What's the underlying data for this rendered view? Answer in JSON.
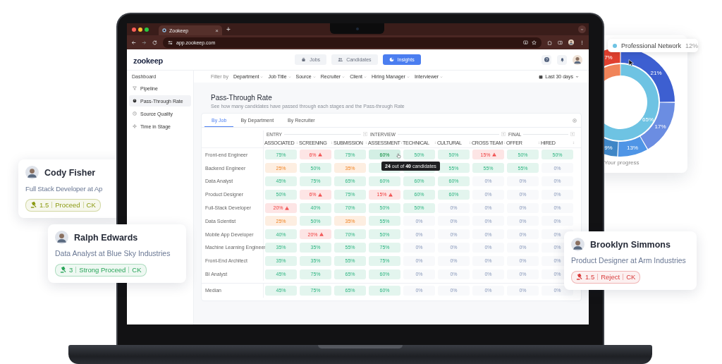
{
  "browser": {
    "tab_title": "Zookeep",
    "tab_close": "×",
    "new_tab": "+",
    "url": "app.zookeep.com"
  },
  "app": {
    "logo": "zookeep",
    "nav": [
      {
        "label": "Jobs",
        "selected": false
      },
      {
        "label": "Candidates",
        "selected": false
      },
      {
        "label": "Insights",
        "selected": true
      }
    ]
  },
  "sidebar": {
    "heading": "Dashboard",
    "items": [
      {
        "label": "Pipeline",
        "selected": false
      },
      {
        "label": "Pass-Through Rate",
        "selected": true
      },
      {
        "label": "Source Quality",
        "selected": false
      },
      {
        "label": "Time in Stage",
        "selected": false
      }
    ]
  },
  "filters": {
    "label": "Filter by",
    "items": [
      "Department",
      "Job Title",
      "Source",
      "Recruiter",
      "Client",
      "Hiring Manager",
      "Interviewer"
    ],
    "date_range": "Last 30 days"
  },
  "report": {
    "title": "Pass-Through Rate",
    "subtitle": "See how many candidates have passed through each stages and the Pass-through Rate",
    "tabs": [
      {
        "label": "By Job",
        "selected": true
      },
      {
        "label": "By Department",
        "selected": false
      },
      {
        "label": "By Recruiter",
        "selected": false
      }
    ],
    "stage_groups": [
      {
        "label": "ENTRY",
        "columns": [
          "ASSOCIATED",
          "SCREENING",
          "SUBMISSION"
        ]
      },
      {
        "label": "INTERVIEW",
        "columns": [
          "ASSESSMENT",
          "TECHNICAL",
          "CULTURAL",
          "CROSS TEAM"
        ]
      },
      {
        "label": "FINAL",
        "columns": [
          "OFFER",
          "HIRED"
        ]
      }
    ],
    "rows": [
      {
        "job": "Front-end Engineer",
        "cells": [
          {
            "value": "75%",
            "color": "#e3f5ee",
            "alert": false
          },
          {
            "value": "6%",
            "color": "#fde5e5",
            "alert": true
          },
          {
            "value": "75%",
            "color": "#e3f5ee",
            "alert": false
          },
          {
            "value": "60%",
            "color": "#d3efe4",
            "alert": false
          },
          {
            "value": "50%",
            "color": "#e3f5ee",
            "alert": false
          },
          {
            "value": "50%",
            "color": "#e3f5ee",
            "alert": false
          },
          {
            "value": "15%",
            "color": "#fde5e5",
            "alert": true
          },
          {
            "value": "50%",
            "color": "#e3f5ee",
            "alert": false
          },
          {
            "value": "50%",
            "color": "#e3f5ee",
            "alert": false
          }
        ]
      },
      {
        "job": "Backend Engineer",
        "cells": [
          {
            "value": "25%",
            "color": "#fdeee1",
            "alert": false
          },
          {
            "value": "50%",
            "color": "#e3f5ee",
            "alert": false
          },
          {
            "value": "35%",
            "color": "#fdeee1",
            "alert": false
          },
          {
            "color": "#e3f5ee"
          },
          {
            "color": "#e3f5ee"
          },
          {
            "value": "55%",
            "color": "#e3f5ee",
            "alert": false
          },
          {
            "value": "55%",
            "color": "#e3f5ee",
            "alert": false
          },
          {
            "value": "55%",
            "color": "#e3f5ee",
            "alert": false
          },
          {
            "value": "0%",
            "color": "#f8f9fb",
            "alert": false
          }
        ]
      },
      {
        "job": "Data Analyst",
        "cells": [
          {
            "value": "45%",
            "color": "#e3f5ee",
            "alert": false
          },
          {
            "value": "75%",
            "color": "#e3f5ee",
            "alert": false
          },
          {
            "value": "65%",
            "color": "#e3f5ee",
            "alert": false
          },
          {
            "value": "60%",
            "color": "#e3f5ee",
            "alert": false
          },
          {
            "value": "60%",
            "color": "#e3f5ee",
            "alert": false
          },
          {
            "value": "60%",
            "color": "#e3f5ee",
            "alert": false
          },
          {
            "value": "0%",
            "color": "#f8f9fb",
            "alert": false
          },
          {
            "value": "0%",
            "color": "#f8f9fb",
            "alert": false
          },
          {
            "value": "0%",
            "color": "#f8f9fb",
            "alert": false
          }
        ]
      },
      {
        "job": "Product Designer",
        "cells": [
          {
            "value": "50%",
            "color": "#e3f5ee",
            "alert": false
          },
          {
            "value": "6%",
            "color": "#fde5e5",
            "alert": true
          },
          {
            "value": "75%",
            "color": "#e3f5ee",
            "alert": false
          },
          {
            "value": "15%",
            "color": "#fde5e5",
            "alert": true
          },
          {
            "value": "60%",
            "color": "#e3f5ee",
            "alert": false
          },
          {
            "value": "60%",
            "color": "#e3f5ee",
            "alert": false
          },
          {
            "value": "0%",
            "color": "#f8f9fb",
            "alert": false
          },
          {
            "value": "0%",
            "color": "#f8f9fb",
            "alert": false
          },
          {
            "value": "0%",
            "color": "#f8f9fb",
            "alert": false
          }
        ]
      },
      {
        "job": "Full-Stack Developer",
        "cells": [
          {
            "value": "20%",
            "color": "#fde5e5",
            "alert": true
          },
          {
            "value": "40%",
            "color": "#e3f5ee",
            "alert": false
          },
          {
            "value": "70%",
            "color": "#e3f5ee",
            "alert": false
          },
          {
            "value": "50%",
            "color": "#e3f5ee",
            "alert": false
          },
          {
            "value": "50%",
            "color": "#e3f5ee",
            "alert": false
          },
          {
            "value": "0%",
            "color": "#f8f9fb",
            "alert": false
          },
          {
            "value": "0%",
            "color": "#f8f9fb",
            "alert": false
          },
          {
            "value": "0%",
            "color": "#f8f9fb",
            "alert": false
          },
          {
            "value": "0%",
            "color": "#f8f9fb",
            "alert": false
          }
        ]
      },
      {
        "job": "Data Scientist",
        "cells": [
          {
            "value": "25%",
            "color": "#fdeee1",
            "alert": false
          },
          {
            "value": "50%",
            "color": "#e3f5ee",
            "alert": false
          },
          {
            "value": "35%",
            "color": "#fdeee1",
            "alert": false
          },
          {
            "value": "55%",
            "color": "#e3f5ee",
            "alert": false
          },
          {
            "value": "0%",
            "color": "#f8f9fb",
            "alert": false
          },
          {
            "value": "0%",
            "color": "#f8f9fb",
            "alert": false
          },
          {
            "value": "0%",
            "color": "#f8f9fb",
            "alert": false
          },
          {
            "value": "0%",
            "color": "#f8f9fb",
            "alert": false
          },
          {
            "value": "0%",
            "color": "#f8f9fb",
            "alert": false
          }
        ]
      },
      {
        "job": "Mobile App Developer",
        "cells": [
          {
            "value": "40%",
            "color": "#e3f5ee",
            "alert": false
          },
          {
            "value": "20%",
            "color": "#fde5e5",
            "alert": true
          },
          {
            "value": "70%",
            "color": "#e3f5ee",
            "alert": false
          },
          {
            "value": "50%",
            "color": "#e3f5ee",
            "alert": false
          },
          {
            "value": "0%",
            "color": "#f8f9fb",
            "alert": false
          },
          {
            "value": "0%",
            "color": "#f8f9fb",
            "alert": false
          },
          {
            "value": "0%",
            "color": "#f8f9fb",
            "alert": false
          },
          {
            "value": "0%",
            "color": "#f8f9fb",
            "alert": false
          },
          {
            "value": "0%",
            "color": "#f8f9fb",
            "alert": false
          }
        ]
      },
      {
        "job": "Machine Learning Engineer",
        "cells": [
          {
            "value": "35%",
            "color": "#e3f5ee",
            "alert": false
          },
          {
            "value": "35%",
            "color": "#e3f5ee",
            "alert": false
          },
          {
            "value": "55%",
            "color": "#e3f5ee",
            "alert": false
          },
          {
            "value": "75%",
            "color": "#e3f5ee",
            "alert": false
          },
          {
            "value": "0%",
            "color": "#f8f9fb",
            "alert": false
          },
          {
            "value": "0%",
            "color": "#f8f9fb",
            "alert": false
          },
          {
            "value": "0%",
            "color": "#f8f9fb",
            "alert": false
          },
          {
            "value": "0%",
            "color": "#f8f9fb",
            "alert": false
          },
          {
            "value": "0%",
            "color": "#f8f9fb",
            "alert": false
          }
        ]
      },
      {
        "job": "Front-End Architect",
        "cells": [
          {
            "value": "35%",
            "color": "#e3f5ee",
            "alert": false
          },
          {
            "value": "35%",
            "color": "#e3f5ee",
            "alert": false
          },
          {
            "value": "55%",
            "color": "#e3f5ee",
            "alert": false
          },
          {
            "value": "75%",
            "color": "#e3f5ee",
            "alert": false
          },
          {
            "value": "0%",
            "color": "#f8f9fb",
            "alert": false
          },
          {
            "value": "0%",
            "color": "#f8f9fb",
            "alert": false
          },
          {
            "value": "0%",
            "color": "#f8f9fb",
            "alert": false
          },
          {
            "value": "0%",
            "color": "#f8f9fb",
            "alert": false
          },
          {
            "value": "0%",
            "color": "#f8f9fb",
            "alert": false
          }
        ]
      },
      {
        "job": "BI Analyst",
        "cells": [
          {
            "value": "45%",
            "color": "#e3f5ee",
            "alert": false
          },
          {
            "value": "75%",
            "color": "#e3f5ee",
            "alert": false
          },
          {
            "value": "65%",
            "color": "#e3f5ee",
            "alert": false
          },
          {
            "value": "60%",
            "color": "#e3f5ee",
            "alert": false
          },
          {
            "value": "0%",
            "color": "#f8f9fb",
            "alert": false
          },
          {
            "value": "0%",
            "color": "#f8f9fb",
            "alert": false
          },
          {
            "value": "0%",
            "color": "#f8f9fb",
            "alert": false
          },
          {
            "value": "0%",
            "color": "#f8f9fb",
            "alert": false
          },
          {
            "value": "0%",
            "color": "#f8f9fb",
            "alert": false
          }
        ]
      }
    ],
    "median": {
      "label": "Median",
      "cells": [
        {
          "value": "45%",
          "color": "#e3f5ee",
          "alert": false
        },
        {
          "value": "75%",
          "color": "#e3f5ee",
          "alert": false
        },
        {
          "value": "65%",
          "color": "#e3f5ee",
          "alert": false
        },
        {
          "value": "60%",
          "color": "#e3f5ee",
          "alert": false
        },
        {
          "value": "0%",
          "color": "#f8f9fb",
          "alert": false
        },
        {
          "value": "0%",
          "color": "#f8f9fb",
          "alert": false
        },
        {
          "value": "0%",
          "color": "#f8f9fb",
          "alert": false
        },
        {
          "value": "0%",
          "color": "#f8f9fb",
          "alert": false
        },
        {
          "value": "0%",
          "color": "#f8f9fb",
          "alert": false
        }
      ]
    },
    "tooltip": "**24** out of **40** candidates"
  },
  "cards": [
    {
      "name": "Cody Fisher",
      "role": "Full Stack Developer at Ap",
      "score": "1.5",
      "verdict": "Proceed",
      "initials": "CK",
      "color": "#8b9a12"
    },
    {
      "name": "Ralph Edwards",
      "role": "Data Analyst at Blue Sky Industries",
      "score": "3",
      "verdict": "Strong Proceed",
      "initials": "CK",
      "color": "#2aa55a"
    },
    {
      "name": "Brooklyn Simmons",
      "role": "Product Designer at Arm Industries",
      "score": "1.5",
      "verdict": "Reject",
      "initials": "CK",
      "color": "#d93b3b"
    }
  ],
  "progress_card": {
    "segment_labels": [
      "7%",
      "21%",
      "17%",
      "13%",
      "9%",
      "65%"
    ],
    "caption": "Your progress",
    "tooltip": {
      "label": "Professional Network",
      "value": "12%"
    }
  }
}
